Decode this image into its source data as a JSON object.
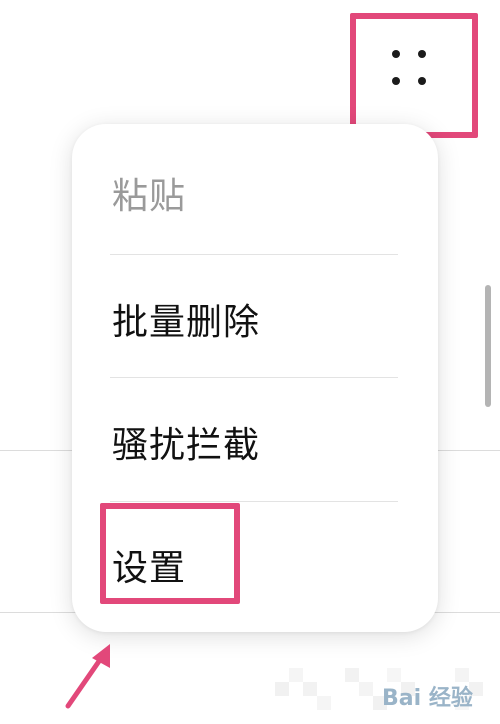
{
  "menu": {
    "items": [
      {
        "label": "粘贴",
        "enabled": false
      },
      {
        "label": "批量删除",
        "enabled": true
      },
      {
        "label": "骚扰拦截",
        "enabled": true
      },
      {
        "label": "设置",
        "enabled": true,
        "highlighted": true
      }
    ]
  },
  "more_button": {
    "icon": "more-dots-icon",
    "highlighted": true
  },
  "annotation": {
    "color": "#e2487a",
    "arrow_icon": "arrow-up-right-icon"
  },
  "watermark": {
    "text": "Bai 经验"
  }
}
